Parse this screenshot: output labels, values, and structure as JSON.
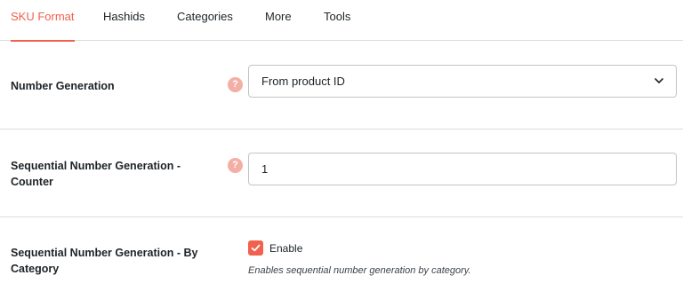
{
  "tabs": [
    {
      "label": "SKU Format",
      "active": true
    },
    {
      "label": "Hashids"
    },
    {
      "label": "Categories"
    },
    {
      "label": "More"
    },
    {
      "label": "Tools"
    }
  ],
  "accent_color": "#f0614e",
  "fields": {
    "number_generation": {
      "label": "Number Generation",
      "help_icon": "question-icon",
      "selected": "From product ID"
    },
    "sequential_counter": {
      "label_line1": "Sequential Number Generation -",
      "label_line2": "Counter",
      "help_icon": "question-icon",
      "value": "1"
    },
    "sequential_by_category": {
      "label_line1": "Sequential Number Generation - By",
      "label_line2": "Category",
      "checkbox_label": "Enable",
      "checked": true,
      "description": "Enables sequential number generation by category."
    }
  }
}
